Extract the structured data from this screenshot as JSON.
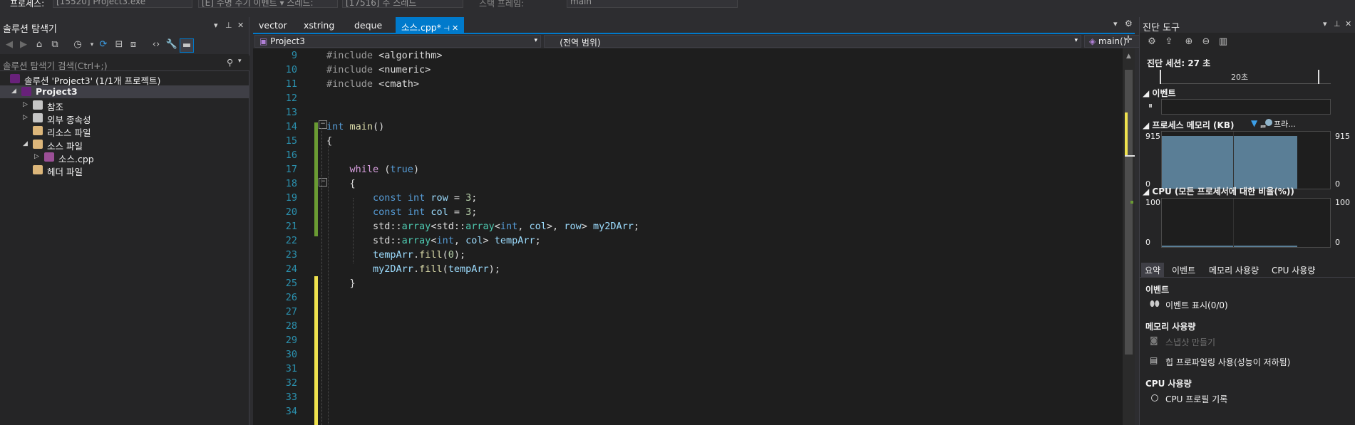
{
  "topbar": {
    "process_label": "프로세스:",
    "process_value": "[15520] Project3.exe",
    "lifecycle_value": "[E] 수명 주기 이벤트 ▾ 스레드:",
    "thread_value": "[17516] 주 스레드",
    "stack_label": "스택 프레임:",
    "stack_value": "main"
  },
  "solution_explorer": {
    "title": "솔루션 탐색기",
    "search_placeholder": "솔루션 탐색기 검색(Ctrl+;)",
    "tree": [
      {
        "label": "솔루션 'Project3' (1/1개 프로젝트)",
        "depth": 0,
        "expander": "",
        "icon": "solution-icon"
      },
      {
        "label": "Project3",
        "depth": 1,
        "expander": "◢",
        "icon": "project-icon",
        "bold": true,
        "selected": true
      },
      {
        "label": "참조",
        "depth": 2,
        "expander": "▷",
        "icon": "references-icon"
      },
      {
        "label": "외부 종속성",
        "depth": 2,
        "expander": "▷",
        "icon": "external-deps-icon"
      },
      {
        "label": "리소스 파일",
        "depth": 2,
        "expander": "",
        "icon": "folder-icon"
      },
      {
        "label": "소스 파일",
        "depth": 2,
        "expander": "◢",
        "icon": "folder-icon"
      },
      {
        "label": "소스.cpp",
        "depth": 3,
        "expander": "▷",
        "icon": "cpp-file-icon"
      },
      {
        "label": "헤더 파일",
        "depth": 2,
        "expander": "",
        "icon": "folder-icon"
      }
    ]
  },
  "editor": {
    "tabs": [
      {
        "label": "vector",
        "active": false
      },
      {
        "label": "xstring",
        "active": false
      },
      {
        "label": "deque",
        "active": false
      },
      {
        "label": "소스.cpp*",
        "active": true
      }
    ],
    "nav": {
      "project": "Project3",
      "scope": "(전역 범위)",
      "function": "main()"
    },
    "lines": [
      {
        "n": 9,
        "tokens": [
          [
            "pp",
            "#include "
          ],
          [
            "",
            "<algorithm>"
          ]
        ]
      },
      {
        "n": 10,
        "tokens": [
          [
            "pp",
            "#include "
          ],
          [
            "",
            "<numeric>"
          ]
        ]
      },
      {
        "n": 11,
        "tokens": [
          [
            "pp",
            "#include "
          ],
          [
            "",
            "<cmath>"
          ]
        ]
      },
      {
        "n": 12,
        "tokens": []
      },
      {
        "n": 13,
        "tokens": []
      },
      {
        "n": 14,
        "tokens": [
          [
            "kw",
            "int"
          ],
          [
            "",
            " "
          ],
          [
            "fn",
            "main"
          ],
          [
            "",
            "()"
          ]
        ]
      },
      {
        "n": 15,
        "tokens": [
          [
            "",
            "{"
          ]
        ]
      },
      {
        "n": 16,
        "tokens": []
      },
      {
        "n": 17,
        "tokens": [
          [
            "",
            "    "
          ],
          [
            "ctl",
            "while"
          ],
          [
            "",
            " ("
          ],
          [
            "kw",
            "true"
          ],
          [
            "",
            ")"
          ]
        ]
      },
      {
        "n": 18,
        "tokens": [
          [
            "",
            "    {"
          ]
        ]
      },
      {
        "n": 19,
        "tokens": [
          [
            "",
            "        "
          ],
          [
            "kw",
            "const"
          ],
          [
            "",
            " "
          ],
          [
            "kw",
            "int"
          ],
          [
            "",
            " "
          ],
          [
            "var",
            "row"
          ],
          [
            "",
            " = "
          ],
          [
            "num",
            "3"
          ],
          [
            "",
            ";"
          ]
        ]
      },
      {
        "n": 20,
        "tokens": [
          [
            "",
            "        "
          ],
          [
            "kw",
            "const"
          ],
          [
            "",
            " "
          ],
          [
            "kw",
            "int"
          ],
          [
            "",
            " "
          ],
          [
            "var",
            "col"
          ],
          [
            "",
            " = "
          ],
          [
            "num",
            "3"
          ],
          [
            "",
            ";"
          ]
        ]
      },
      {
        "n": 21,
        "tokens": [
          [
            "",
            "        std::"
          ],
          [
            "ty",
            "array"
          ],
          [
            "",
            "<std::"
          ],
          [
            "ty",
            "array"
          ],
          [
            "",
            "<"
          ],
          [
            "kw",
            "int"
          ],
          [
            "",
            ", "
          ],
          [
            "var",
            "col"
          ],
          [
            "",
            ">, "
          ],
          [
            "var",
            "row"
          ],
          [
            "",
            "> "
          ],
          [
            "var",
            "my2DArr"
          ],
          [
            "",
            ";"
          ]
        ]
      },
      {
        "n": 22,
        "tokens": [
          [
            "",
            "        std::"
          ],
          [
            "ty",
            "array"
          ],
          [
            "",
            "<"
          ],
          [
            "kw",
            "int"
          ],
          [
            "",
            ", "
          ],
          [
            "var",
            "col"
          ],
          [
            "",
            "> "
          ],
          [
            "var",
            "tempArr"
          ],
          [
            "",
            ";"
          ]
        ]
      },
      {
        "n": 23,
        "tokens": [
          [
            "",
            "        "
          ],
          [
            "var",
            "tempArr"
          ],
          [
            "",
            "."
          ],
          [
            "fn",
            "fill"
          ],
          [
            "",
            "("
          ],
          [
            "num",
            "0"
          ],
          [
            "",
            ");"
          ]
        ]
      },
      {
        "n": 24,
        "tokens": [
          [
            "",
            "        "
          ],
          [
            "var",
            "my2DArr"
          ],
          [
            "",
            "."
          ],
          [
            "fn",
            "fill"
          ],
          [
            "",
            "("
          ],
          [
            "var",
            "tempArr"
          ],
          [
            "",
            ");"
          ]
        ]
      },
      {
        "n": 25,
        "tokens": [
          [
            "",
            "    }"
          ]
        ]
      },
      {
        "n": 26,
        "tokens": []
      },
      {
        "n": 27,
        "tokens": []
      },
      {
        "n": 28,
        "tokens": []
      },
      {
        "n": 29,
        "tokens": []
      },
      {
        "n": 30,
        "tokens": []
      },
      {
        "n": 31,
        "tokens": []
      },
      {
        "n": 32,
        "tokens": []
      },
      {
        "n": 33,
        "tokens": []
      },
      {
        "n": 34,
        "tokens": []
      }
    ]
  },
  "diagnostics": {
    "title": "진단 도구",
    "session": "진단 세션: 27 초",
    "timeline_label": "20초",
    "events_header": "이벤트",
    "memory_header": "프로세스 메모리 (KB)",
    "memory_legend_a": "ᆯ",
    "memory_legend_b": "프라...",
    "memory_max_left": "915",
    "memory_max_right": "915",
    "memory_min_left": "0",
    "memory_min_right": "0",
    "cpu_header": "CPU (모든 프로세서에 대한 비율(%))",
    "cpu_max_left": "100",
    "cpu_max_right": "100",
    "cpu_min_left": "0",
    "cpu_min_right": "0",
    "memory_fill": 0.93,
    "cpu_fill": 0.02,
    "subtabs": [
      "요약",
      "이벤트",
      "메모리 사용량",
      "CPU 사용량"
    ],
    "sec_events": "이벤트",
    "show_events": "이벤트 표시(0/0)",
    "sec_memory": "메모리 사용량",
    "snapshot": "스냅샷 만들기",
    "heap_profiling": "힙 프로파일링 사용(성능이 저하됨)",
    "sec_cpu": "CPU 사용량",
    "cpu_profile": "CPU 프로필 기록"
  }
}
